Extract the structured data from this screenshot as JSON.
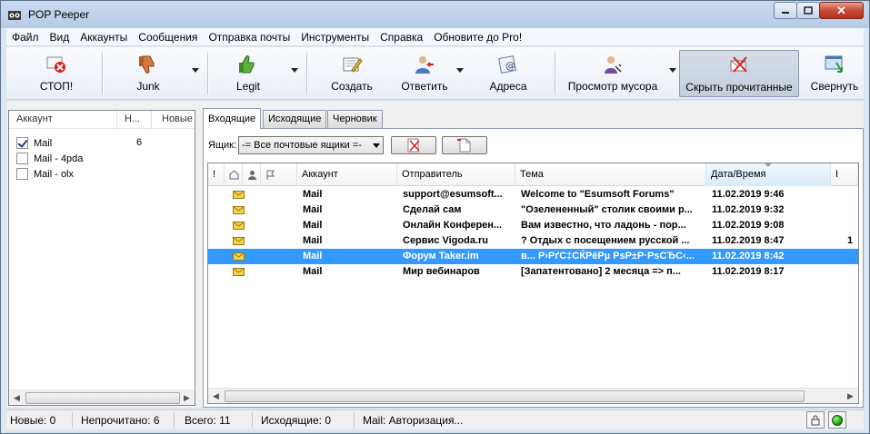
{
  "window": {
    "title": "POP Peeper"
  },
  "menu": [
    "Файл",
    "Вид",
    "Аккаунты",
    "Сообщения",
    "Отправка почты",
    "Инструменты",
    "Справка",
    "Обновите до Pro!"
  ],
  "toolbar": {
    "stop": "СТОП!",
    "junk": "Junk",
    "legit": "Legit",
    "create": "Создать",
    "reply": "Ответить",
    "addresses": "Адреса",
    "view_trash": "Просмотр мусора",
    "hide_read": "Скрыть прочитанные",
    "minimize": "Свернуть"
  },
  "accounts": {
    "headers": {
      "account": "Аккаунт",
      "new_short": "Н...",
      "new": "Новые"
    },
    "items": [
      {
        "name": "Mail",
        "count": "6",
        "checked": true
      },
      {
        "name": "Mail - 4pda",
        "count": "",
        "checked": false
      },
      {
        "name": "Mail - olx",
        "count": "",
        "checked": false
      }
    ]
  },
  "tabs": [
    "Входящие",
    "Исходящие",
    "Черновик"
  ],
  "mailbox": {
    "label": "Ящик:",
    "selected": "-= Все почтовые ящики =-"
  },
  "columns": {
    "importance": "!",
    "account": "Аккаунт",
    "sender": "Отправитель",
    "subject": "Тема",
    "datetime": "Дата/Время",
    "extra": "I"
  },
  "messages": [
    {
      "account": "Mail",
      "sender": "support@esumsoft...",
      "subject": "Welcome to \"Esumsoft Forums\"",
      "date": "11.02.2019 9:46",
      "extra": "",
      "selected": false
    },
    {
      "account": "Mail",
      "sender": "Сделай сам",
      "subject": "\"Озелененный\" столик своими р...",
      "date": "11.02.2019 9:32",
      "extra": "",
      "selected": false
    },
    {
      "account": "Mail",
      "sender": "Онлайн Конферен...",
      "subject": "Вам известно, что ладонь - пор...",
      "date": "11.02.2019 9:08",
      "extra": "",
      "selected": false
    },
    {
      "account": "Mail",
      "sender": "Сервис Vigoda.ru",
      "subject": "? Отдых с посещением русской ...",
      "date": "11.02.2019 8:47",
      "extra": "1",
      "selected": false
    },
    {
      "account": "Mail",
      "sender": "Форум Taker.im",
      "subject": "в... Р›РґС‡СЌРёРµ РѕР±Р·РѕСЂС‹...",
      "date": "11.02.2019 8:42",
      "extra": "",
      "selected": true
    },
    {
      "account": "Mail",
      "sender": "Мир вебинаров",
      "subject": "[Запатентовано] 2 месяца => п...",
      "date": "11.02.2019 8:17",
      "extra": "",
      "selected": false
    }
  ],
  "status": {
    "new": "Новые: 0",
    "unread": "Непрочитано: 6",
    "total": "Всего: 11",
    "outgoing": "Исходящие: 0",
    "action": "Mail: Авторизация..."
  }
}
